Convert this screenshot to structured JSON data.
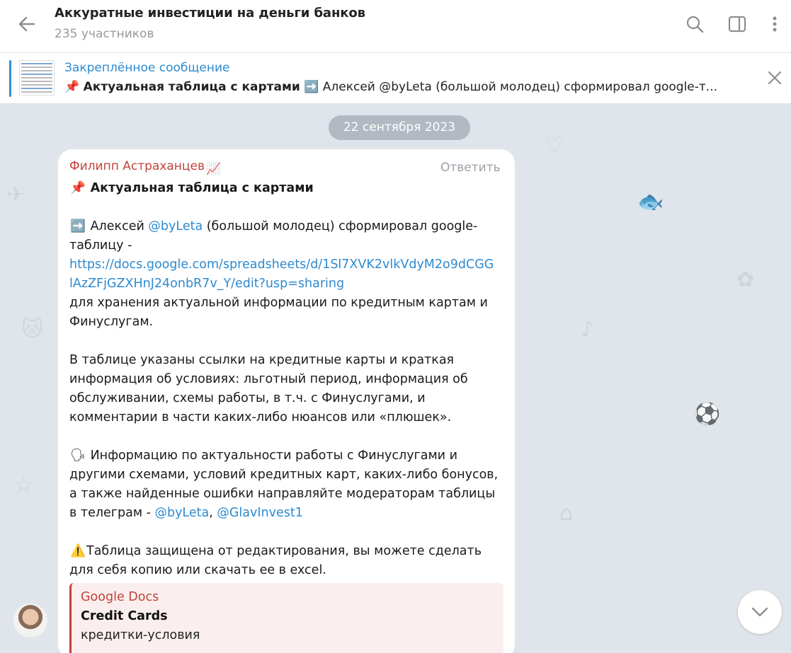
{
  "header": {
    "title": "Аккуратные инвестиции на деньги банков",
    "subtitle": "235 участников"
  },
  "pinned": {
    "label": "Закреплённое сообщение",
    "emoji": "📌",
    "title": "Актуальная таблица с картами",
    "arrow": "➡️",
    "preview": "Алексей @byLeta (большой молодец) сформировал google-т..."
  },
  "chat": {
    "date": "22 сентября 2023"
  },
  "message": {
    "author": "Филипп Астраханцев",
    "author_emoji": "📈",
    "reply_label": "Ответить",
    "pin_emoji": "📌",
    "headline": "Актуальная таблица с картами",
    "arrow_emoji": "➡️",
    "p1_a": "Алексей ",
    "p1_mention": "@byLeta",
    "p1_b": " (большой молодец) сформировал google-",
    "p1_line2": "таблицу -",
    "link_line1": "https://docs.google.com/spreadsheets/d/1Sl7XVK2vlkVdyM2o9dCGG",
    "link_line2": "lAzZFjGZXHnJ24onbR7v_Y/edit?usp=sharing",
    "p1_line3": "для хранения актуальной информации по кредитным картам и",
    "p1_line4": "Финуслугам.",
    "p2_line1": "В таблице указаны ссылки на кредитные карты и краткая",
    "p2_line2": "информация об условиях: льготный период, информация об",
    "p2_line3": "обслуживании, схемы работы, в т.ч. с Финуслугами, и",
    "p2_line4": "комментарии в части каких-либо нюансов или «плюшек».",
    "speak_emoji": "🗣",
    "p3_line1": " Информацию по актуальности работы с Финуслугами и",
    "p3_line2": "другими схемами, условий кредитных карт, каких-либо бонусов,",
    "p3_line3": "а также найденные ошибки направляйте модераторам таблицы",
    "p3_line4": "в телеграм - ",
    "p3_mention1": "@byLeta",
    "p3_comma": ", ",
    "p3_mention2": "@GlavInvest1",
    "warn_emoji": "⚠️",
    "p4_line1": "Таблица защищена от редактирования, вы можете сделать",
    "p4_line2": "для себя копию или скачать ее в excel.",
    "link_preview": {
      "site": "Google Docs",
      "title": "Credit Cards",
      "description": "кредитки-условия"
    }
  },
  "colors": {
    "accent": "#2e8ad0",
    "author": "#c0433c",
    "background": "#dfe5ea"
  }
}
